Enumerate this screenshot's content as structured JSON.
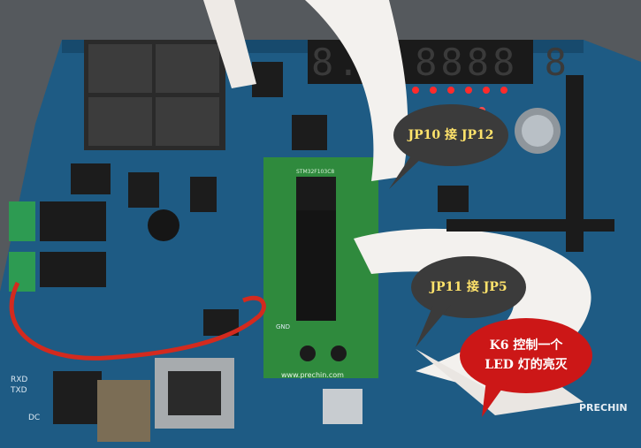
{
  "scene": {
    "subject": "STM32 development board photo",
    "colors": {
      "pcb": "#1e5b84",
      "pcb_dark": "#174a6d",
      "ribbon": "#f3f1ee",
      "digits": "#1a1a1a",
      "led_red": "#ff2b2b",
      "callout_dark": "#3b3b3b",
      "callout_red": "#cc1717",
      "callout_text_yellow": "#ffe36b"
    }
  },
  "board_labels": {
    "mcu": "STM32F103C8",
    "site": "www.prechin.com",
    "brand": "PRECHIN",
    "port_labels": [
      "GND",
      "RXD",
      "TXD",
      "DC"
    ]
  },
  "callouts": {
    "jp10": "JP10 接 JP12",
    "jp11": "JP11 接 JP5",
    "k6_line1": "K6 控制一个",
    "k6_line2": "LED 灯的亮灭"
  }
}
